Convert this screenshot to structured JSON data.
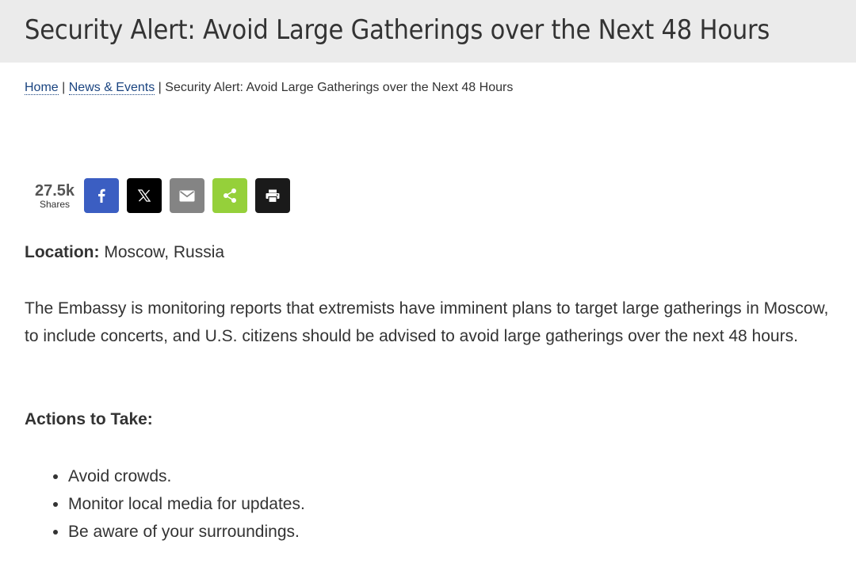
{
  "header": {
    "title": "Security Alert: Avoid Large Gatherings over the Next 48 Hours"
  },
  "breadcrumb": {
    "home": "Home",
    "separator": " | ",
    "news": "News & Events",
    "current": "Security Alert: Avoid Large Gatherings over the Next 48 Hours"
  },
  "share": {
    "count": "27.5k",
    "count_label": "Shares",
    "buttons": [
      {
        "name": "facebook",
        "icon": "facebook-icon",
        "color": "#3b5ec2"
      },
      {
        "name": "x",
        "icon": "x-icon",
        "color": "#000000"
      },
      {
        "name": "email",
        "icon": "email-icon",
        "color": "#848484"
      },
      {
        "name": "share",
        "icon": "share-icon",
        "color": "#95d03a"
      },
      {
        "name": "print",
        "icon": "print-icon",
        "color": "#1a1a1a"
      }
    ]
  },
  "content": {
    "location_label": "Location:",
    "location_value": " Moscow, Russia",
    "paragraph": "The Embassy is monitoring reports that extremists have imminent plans to target large gatherings in Moscow, to include concerts, and U.S. citizens should be advised to avoid large gatherings over the next 48 hours.",
    "actions_heading": "Actions to Take:",
    "actions": [
      "Avoid crowds.",
      "Monitor local media for updates.",
      "Be aware of your surroundings."
    ]
  },
  "colors": {
    "title_bar_bg": "#ebebeb",
    "link": "#1a4480",
    "text": "#333333"
  }
}
